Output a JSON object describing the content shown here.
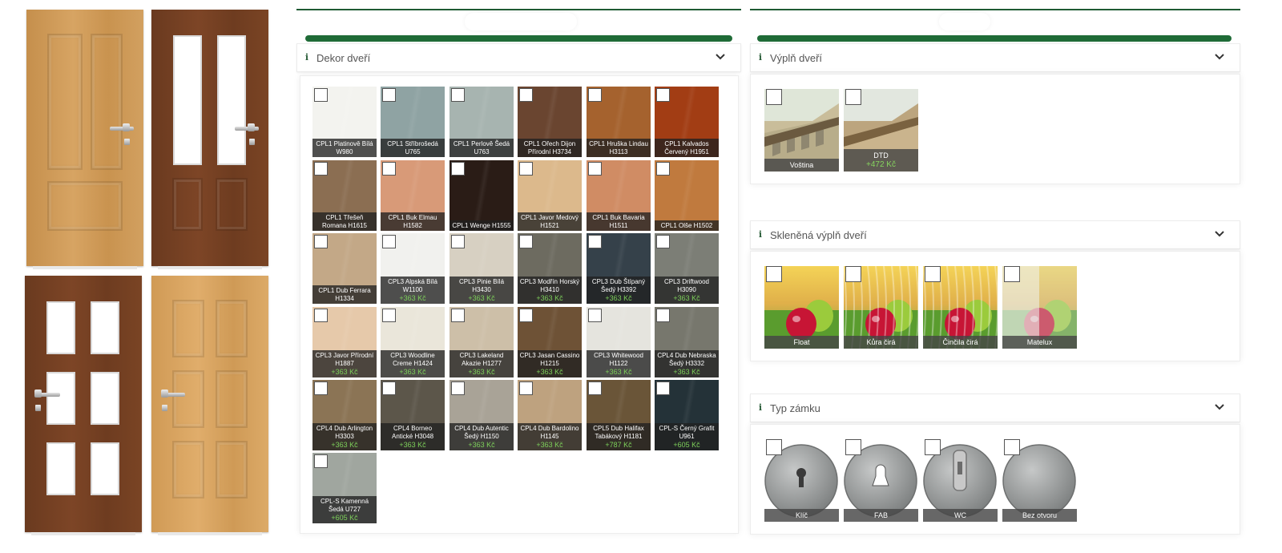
{
  "colors": {
    "accent_green": "#1f6b37",
    "price_green": "#7dd05a",
    "label_bg": "#202020"
  },
  "door_previews": [
    {
      "name": "door-panel-oak",
      "style": "4-panel solid"
    },
    {
      "name": "door-walnut-glass-2",
      "style": "2 tall glass + 2 panels"
    },
    {
      "name": "door-walnut-glass-6",
      "style": "6 glass lites"
    },
    {
      "name": "door-oak-6-panel",
      "style": "6 panels"
    }
  ],
  "decor": {
    "title": "Dekor dveří",
    "icon": "info-icon",
    "items": [
      {
        "label": "CPL1 Platinově Bílá W980",
        "price": "",
        "color": "#f3f3ef"
      },
      {
        "label": "CPL1 Stříbrošedá U765",
        "price": "",
        "color": "#8fa3a3"
      },
      {
        "label": "CPL1 Perlově Šedá U763",
        "price": "",
        "color": "#a7b4b0"
      },
      {
        "label": "CPL1 Ořech Dijon Přírodní H3734",
        "price": "",
        "color": "#6a4530"
      },
      {
        "label": "CPL1 Hruška Lindau H3113",
        "price": "",
        "color": "#a5622e"
      },
      {
        "label": "CPL1 Kalvados Červený H1951",
        "price": "",
        "color": "#a23d14"
      },
      {
        "label": "CPL1 Třešeň Romana H1615",
        "price": "",
        "color": "#8b6e52"
      },
      {
        "label": "CPL1 Buk Elmau H1582",
        "price": "",
        "color": "#d89a78"
      },
      {
        "label": "CPL1 Wenge H1555",
        "price": "",
        "color": "#2a1c16"
      },
      {
        "label": "CPL1 Javor Medový H1521",
        "price": "",
        "color": "#dcb98c"
      },
      {
        "label": "CPL1 Buk Bavaria H1511",
        "price": "",
        "color": "#d08c64"
      },
      {
        "label": "CPL1 Olše H1502",
        "price": "",
        "color": "#c07a3e"
      },
      {
        "label": "CPL1 Dub Ferrara H1334",
        "price": "",
        "color": "#c3a887"
      },
      {
        "label": "CPL3 Alpská Bílá W1100",
        "price": "+363 Kč",
        "color": "#f1f1ee"
      },
      {
        "label": "CPL3 Pinie Bílá H3430",
        "price": "+363 Kč",
        "color": "#d7d0c2"
      },
      {
        "label": "CPL3 Modřín Horský H3410",
        "price": "+363 Kč",
        "color": "#6d6b60"
      },
      {
        "label": "CPL3 Dub Štípaný Šedý H3392",
        "price": "+363 Kč",
        "color": "#35414a"
      },
      {
        "label": "CPL3 Driftwood H3090",
        "price": "+363 Kč",
        "color": "#7c7e76"
      },
      {
        "label": "CPL3 Javor Přírodní H1887",
        "price": "+363 Kč",
        "color": "#e6c9aa"
      },
      {
        "label": "CPL3 Woodline Creme H1424",
        "price": "+363 Kč",
        "color": "#eae6da"
      },
      {
        "label": "CPL3 Lakeland Akazie H1277",
        "price": "+363 Kč",
        "color": "#cdbfa8"
      },
      {
        "label": "CPL3 Jasan Cassino H1215",
        "price": "+363 Kč",
        "color": "#6e5236"
      },
      {
        "label": "CPL3 Whitewood H1122",
        "price": "+363 Kč",
        "color": "#e5e4de"
      },
      {
        "label": "CPL4 Dub Nebraska Šedý H3332",
        "price": "+363 Kč",
        "color": "#77776d"
      },
      {
        "label": "CPL4 Dub Arlington H3303",
        "price": "+363 Kč",
        "color": "#8b7455"
      },
      {
        "label": "CPL4 Borneo Antické H3048",
        "price": "+363 Kč",
        "color": "#5c564a"
      },
      {
        "label": "CPL4 Dub Autentic Šedý H1150",
        "price": "+363 Kč",
        "color": "#a9a397"
      },
      {
        "label": "CPL4 Dub Bardolino H1145",
        "price": "+363 Kč",
        "color": "#bea27f"
      },
      {
        "label": "CPL5 Dub Halifax Tabákový H1181",
        "price": "+787 Kč",
        "color": "#6a5538"
      },
      {
        "label": "CPL-S Černý Grafit U961",
        "price": "+605 Kč",
        "color": "#243238"
      },
      {
        "label": "CPL-S Kamenná Šedá U727",
        "price": "+605 Kč",
        "color": "#a0a69f"
      }
    ]
  },
  "fill": {
    "title": "Výplň dveří",
    "icon": "info-icon",
    "items": [
      {
        "label": "Voština",
        "price": ""
      },
      {
        "label": "DTD",
        "price": "+472 Kč"
      }
    ]
  },
  "glass": {
    "title": "Skleněná výplň dveří",
    "icon": "info-icon",
    "items": [
      {
        "label": "Float"
      },
      {
        "label": "Kůra čirá"
      },
      {
        "label": "Činčila čirá"
      },
      {
        "label": "Matelux"
      }
    ]
  },
  "lock": {
    "title": "Typ zámku",
    "icon": "info-icon",
    "items": [
      {
        "label": "Klíč"
      },
      {
        "label": "FAB"
      },
      {
        "label": "WC"
      },
      {
        "label": "Bez otvoru"
      }
    ]
  }
}
